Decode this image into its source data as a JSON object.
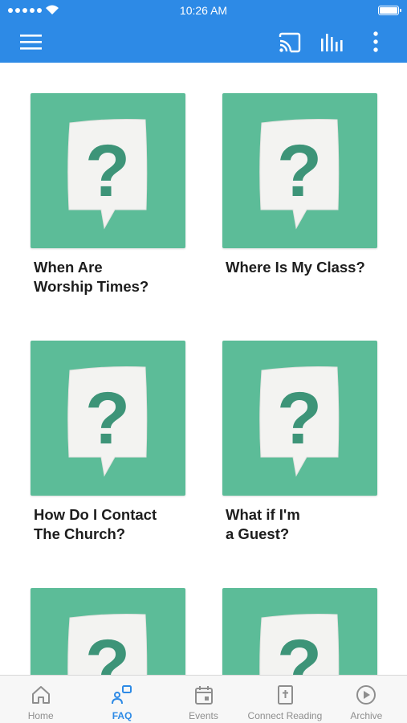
{
  "status_bar": {
    "time": "10:26 AM"
  },
  "app_bar": {
    "menu_icon": "hamburger-menu-icon",
    "cast_icon": "cast-icon",
    "audio_icon": "audio-bars-icon",
    "more_icon": "more-vert-icon",
    "background_color": "#2d8ae6"
  },
  "faq_items": [
    {
      "title": "When Are\nWorship Times?",
      "icon": "question-speech-bubble"
    },
    {
      "title": "Where Is My Class?",
      "icon": "question-speech-bubble"
    },
    {
      "title": "How Do I Contact\nThe Church?",
      "icon": "question-speech-bubble"
    },
    {
      "title": "What if I'm\na Guest?",
      "icon": "question-speech-bubble"
    },
    {
      "title": "",
      "icon": "question-speech-bubble"
    },
    {
      "title": "",
      "icon": "question-speech-bubble"
    }
  ],
  "tile_color": "#5cbc98",
  "bottom_nav": {
    "tabs": [
      {
        "label": "Home",
        "icon": "home-icon",
        "active": false
      },
      {
        "label": "FAQ",
        "icon": "faq-icon",
        "active": true
      },
      {
        "label": "Events",
        "icon": "calendar-icon",
        "active": false
      },
      {
        "label": "Connect Reading",
        "icon": "bible-icon",
        "active": false
      },
      {
        "label": "Archive",
        "icon": "play-circle-icon",
        "active": false
      }
    ],
    "active_color": "#2d8ae6"
  }
}
